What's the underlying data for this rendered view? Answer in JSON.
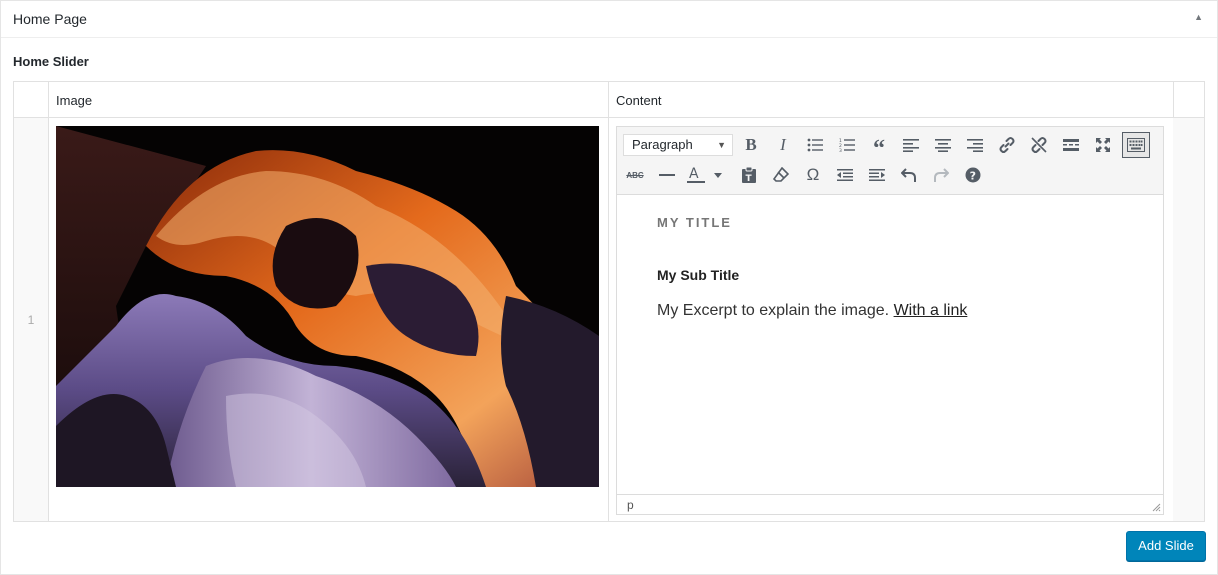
{
  "panel": {
    "title": "Home Page",
    "toggle_icon": "triangle-up-icon"
  },
  "field": {
    "label": "Home Slider"
  },
  "table": {
    "headers": {
      "image": "Image",
      "content": "Content"
    },
    "rows": [
      {
        "order": "1",
        "editor": {
          "format_select": "Paragraph",
          "title": "MY TITLE",
          "subtitle": "My Sub Title",
          "excerpt": "My Excerpt to explain the image. ",
          "link_text": "With a link",
          "path": "p"
        }
      }
    ]
  },
  "toolbar": {
    "row1": [
      "bold-icon",
      "italic-icon",
      "bullet-list-icon",
      "numbered-list-icon",
      "blockquote-icon",
      "align-left-icon",
      "align-center-icon",
      "align-right-icon",
      "insert-link-icon",
      "remove-link-icon",
      "read-more-icon",
      "fullscreen-icon",
      "toolbar-toggle-icon"
    ],
    "row2": [
      "strikethrough-icon",
      "horizontal-line-icon",
      "text-color-icon",
      "paste-text-icon",
      "clear-formatting-icon",
      "special-character-icon",
      "outdent-icon",
      "indent-icon",
      "undo-icon",
      "redo-icon",
      "help-icon"
    ]
  },
  "actions": {
    "add_slide": "Add Slide"
  },
  "colors": {
    "primary": "#0085ba",
    "border": "#e1e1e1"
  }
}
